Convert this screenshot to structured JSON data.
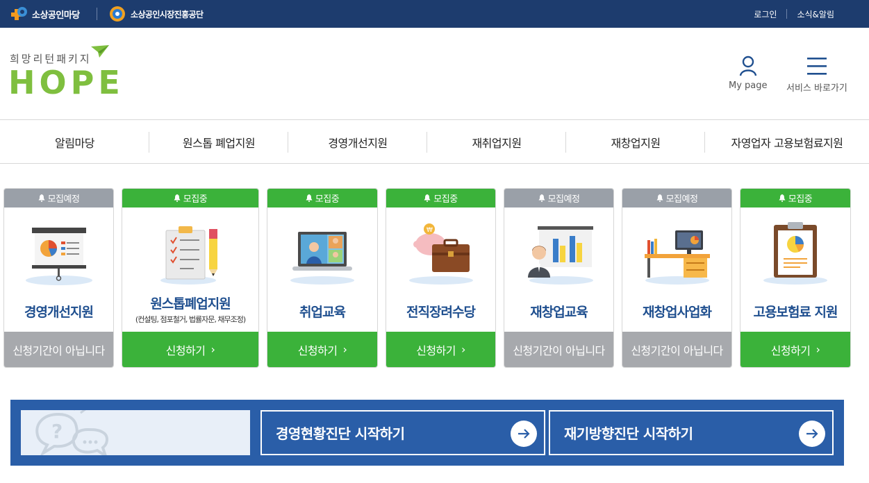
{
  "topbar": {
    "brand1": "소상공인마당",
    "brand2": "소상공인시장진흥공단",
    "login": "로그인",
    "news": "소식&알림"
  },
  "header": {
    "logo_sub": "희망리턴패키지",
    "logo_main": "HOPE",
    "mypage": "My page",
    "menu": "서비스 바로가기"
  },
  "nav": [
    "알림마당",
    "원스톱 폐업지원",
    "경영개선지원",
    "재취업지원",
    "재창업지원",
    "자영업자 고용보험료지원"
  ],
  "cards": [
    {
      "status": "모집예정",
      "title": "경영개선지원",
      "subtitle": "",
      "action": "신청기간이 아닙니다"
    },
    {
      "status": "모집중",
      "title": "원스톱폐업지원",
      "subtitle": "(컨설팅, 점포철거, 법률자문, 채무조정)",
      "action": "신청하기"
    },
    {
      "status": "모집중",
      "title": "취업교육",
      "subtitle": "",
      "action": "신청하기"
    },
    {
      "status": "모집중",
      "title": "전직장려수당",
      "subtitle": "",
      "action": "신청하기"
    },
    {
      "status": "모집예정",
      "title": "재창업교육",
      "subtitle": "",
      "action": "신청기간이 아닙니다"
    },
    {
      "status": "모집예정",
      "title": "재창업사업화",
      "subtitle": "",
      "action": "신청기간이 아닙니다"
    },
    {
      "status": "모집중",
      "title": "고용보험료 지원",
      "subtitle": "",
      "action": "신청하기"
    }
  ],
  "banner": {
    "diag1": "경영현황진단 시작하기",
    "diag2": "재기방향진단 시작하기"
  },
  "colors": {
    "topbar": "#1d3c6e",
    "green": "#3bb23a",
    "gray": "#a7a9ad",
    "title_blue": "#1f4f8f",
    "banner": "#2a5ea8"
  }
}
